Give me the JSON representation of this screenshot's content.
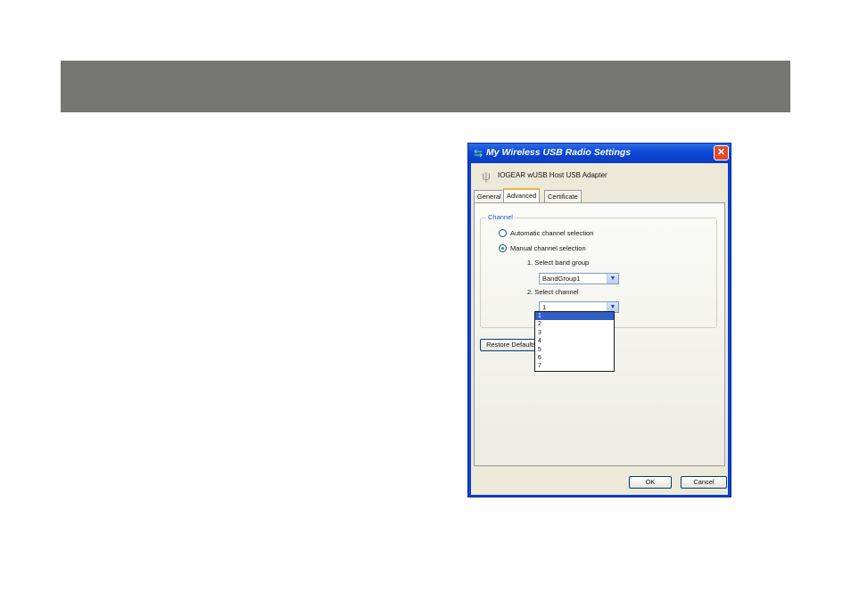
{
  "dialog": {
    "title": "My Wireless USB Radio Settings",
    "device_name": "IOGEAR wUSB Host USB Adapter",
    "tabs": [
      {
        "label": "General",
        "active": false
      },
      {
        "label": "Advanced",
        "active": true
      },
      {
        "label": "Certificate",
        "active": false
      }
    ],
    "channel_group": {
      "legend": "Channel",
      "auto_label": "Automatic channel selection",
      "manual_label": "Manual channel selection",
      "band_label": "1. Select band group",
      "band_value": "BandGroup1",
      "channel_label": "2. Select channel",
      "channel_value": "1"
    },
    "restore_label": "Restore Defaults",
    "channel_options": [
      "1",
      "2",
      "3",
      "4",
      "5",
      "6",
      "7"
    ],
    "ok_label": "OK",
    "cancel_label": "Cancel"
  },
  "icons": {
    "title_icon": "wireless-usb-icon",
    "device_icon": "usb-icon",
    "close": "close-icon",
    "dropdown": "chevron-down-icon"
  },
  "colors": {
    "banner": "#767772",
    "titlebar": "#0d48d6",
    "selected_option": "#2f5fc7"
  }
}
